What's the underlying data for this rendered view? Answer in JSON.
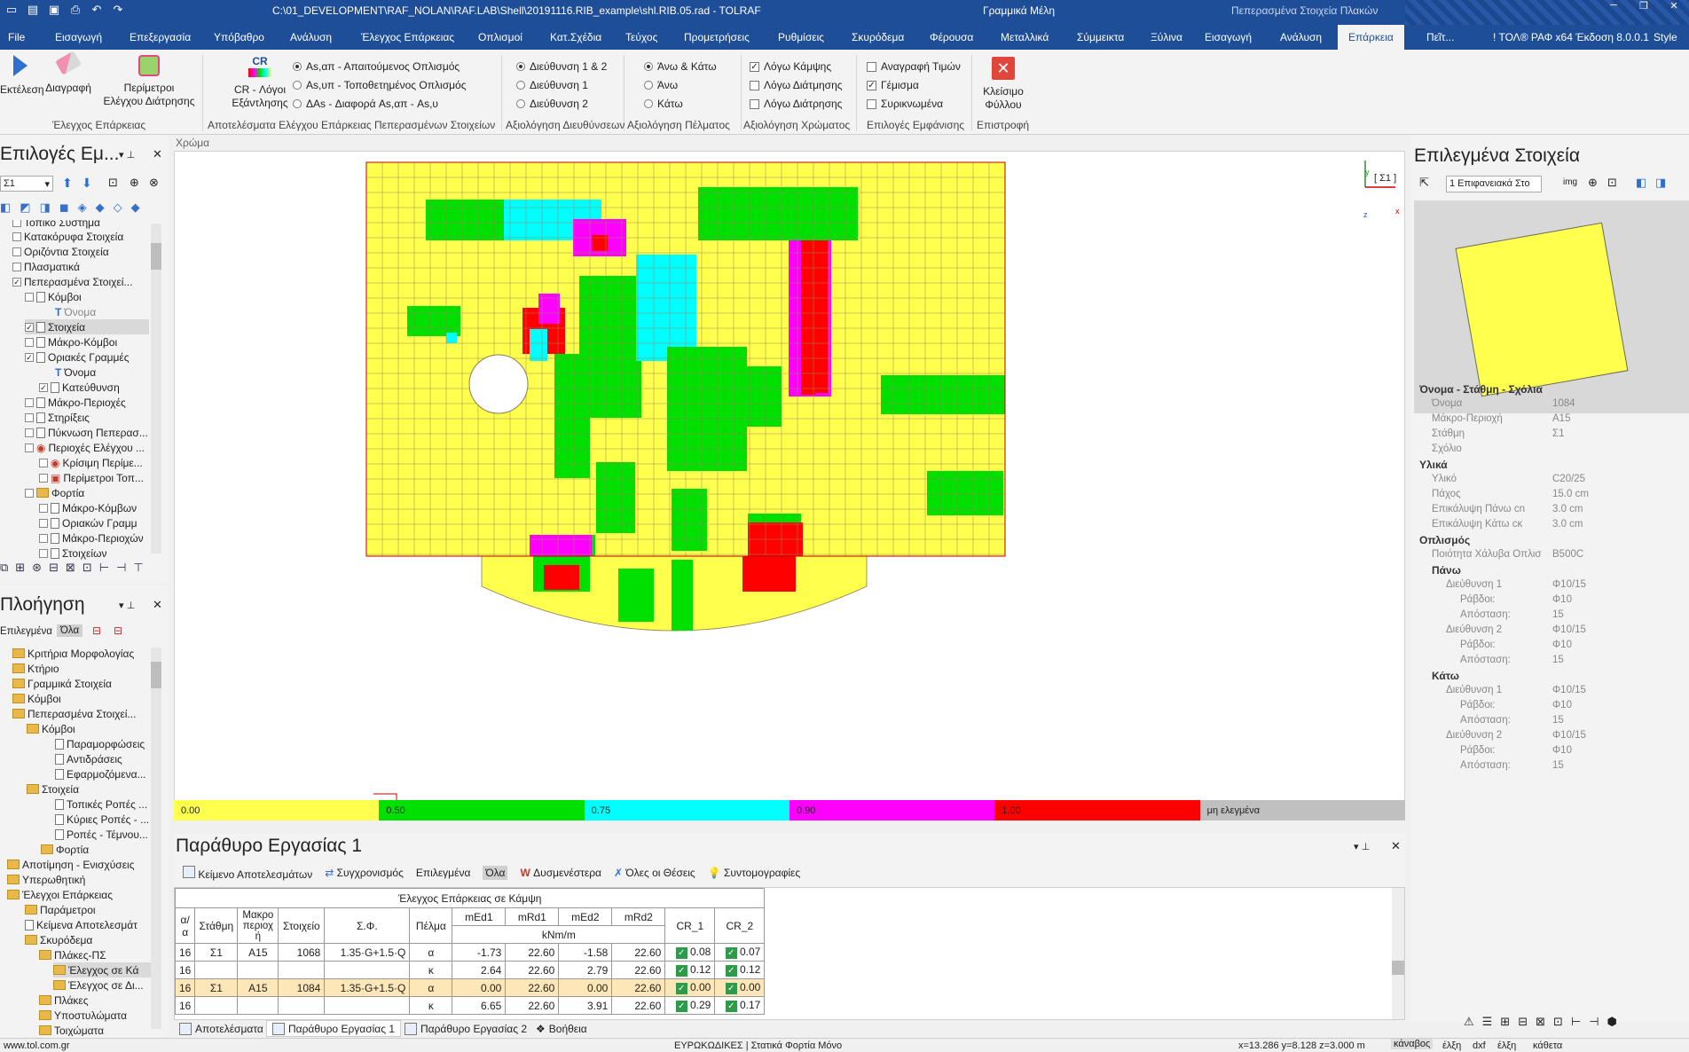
{
  "title_bar": {
    "path": "C:\\01_DEVELOPMENT\\RAF_NOLAN\\RAF.LAB\\Shell\\20191116.RIB_example\\shl.RIB.05.rad - TOLRAF",
    "context1": "Γραμμικά Μέλη",
    "context2": "Πεπερασμένα Στοιχεία Πλακών"
  },
  "menu": {
    "items": [
      "File",
      "Εισαγωγή",
      "Επεξεργασία",
      "Υπόβαθρο",
      "Ανάλυση",
      "Έλεγχος Επάρκειας",
      "Οπλισμοί",
      "Κατ.Σχέδια",
      "Τεύχος",
      "Προμετρήσεις",
      "Ρυθμίσεις",
      "Σκυρόδεμα",
      "Φέρουσα",
      "Μεταλλικά",
      "Σύμμεικτα",
      "Ξύλινα",
      "Εισαγωγή",
      "Ανάλυση",
      "Επάρκεια"
    ],
    "search": "Πεῖτ...",
    "version": "! ΤΟΛ® ΡΑΦ x64 Έκδοση 8.0.0.1",
    "style": "Style"
  },
  "ribbon": {
    "run_label": "Εκτέλεση",
    "delete_label": "Διαγραφή",
    "perimeter_label1": "Περίμετροι",
    "perimeter_label2": "Ελέγχου Διάτρησης",
    "cr_icon_text": "CR",
    "cr_label1": "CR - Λόγοι",
    "cr_label2": "Εξάντλησης",
    "results_opts": [
      "As,απ - Απαιτούμενος Οπλισμός",
      "As,υπ - Τοποθετημένος Οπλισμός",
      "ΔAs - Διαφορά As,απ - As,υ"
    ],
    "direction_opts": [
      "Διεύθυνση 1 & 2",
      "Διεύθυνση 1",
      "Διεύθυνση 2"
    ],
    "flange_opts": [
      "Άνω & Κάτω",
      "Άνω",
      "Κάτω"
    ],
    "color_opts": [
      "Λόγω Κάμψης",
      "Λόγω Διάτμησης",
      "Λόγω Διάτρησης"
    ],
    "display_opts": [
      "Αναγραφή Τιμών",
      "Γέμισμα",
      "Συρικνωμένα"
    ],
    "close_label1": "Κλείσιμο",
    "close_label2": "Φύλλου",
    "groups": [
      "Έλεγχος Επάρκειας",
      "Αποτελέσματα Ελέγχου Επάρκειας Πεπερασμένων Στοιχείων",
      "Αξιολόγηση Διευθύνσεων",
      "Αξιολόγηση Πέλματος",
      "Αξιολόγηση Χρώματος",
      "Επιλογές Εμφάνισης",
      "Επιστροφή"
    ]
  },
  "left_top_panel": {
    "title": "Επιλογές Εμ...",
    "level": "Σ1",
    "rows": [
      "Τοπικό Σύστημα",
      "Κατακόρυφα Στοιχεία",
      "Οριζόντια Στοιχεία",
      "Πλασματικά",
      "Πεπερασμένα Στοιχεί...",
      "Κόμβοι",
      "Όνομα",
      "Στοιχεία",
      "Μάκρο-Κόμβοι",
      "Οριακές Γραμμές",
      "Όνομα",
      "Κατεύθυνση",
      "Μάκρο-Περιοχές",
      "Στηρίξεις",
      "Πύκνωση Πεπερασ...",
      "Περιοχές Ελέγχου ...",
      "Κρίσιμη Περίμε...",
      "Περίμετροι Τοπ...",
      "Φορτία",
      "Μάκρο-Κόμβων",
      "Οριακών Γραμμ",
      "Μάκρο-Περιοχών",
      "Στοιχείων"
    ]
  },
  "left_bottom_panel": {
    "title": "Πλοήγηση",
    "filter_selected": "Επιλεγμένα",
    "filter_all": "Όλα",
    "rows": [
      "Κριτήρια Μορφολογίας",
      "Κτήριο",
      "Γραμμικά Στοιχεία",
      "Κόμβοι",
      "Πεπερασμένα Στοιχεί...",
      "Κόμβοι",
      "Παραμορφώσεις",
      "Αντιδράσεις",
      "Εφαρμοζόμενα...",
      "Στοιχεία",
      "Τοπικές Ροπές ...",
      "Κύριες Ροπές - ...",
      "Ροπές - Τέμνου...",
      "Φορτία",
      "Αποτίμηση - Ενισχύσεις",
      "Υπερωθητική",
      "Έλεγχοι Επάρκειας",
      "Παράμετροι",
      "Κείμενα Αποτελεσμάτ",
      "Σκυρόδεμα",
      "Πλάκες-ΠΣ",
      "Έλεγχος σε Κά",
      "Έλεγχος σε Δι...",
      "Πλάκες",
      "Υποστυλώματα",
      "Τοιχώματα"
    ]
  },
  "canvas": {
    "header": "Χρώμα",
    "view_tag": "[ Σ1 ]",
    "axis_y": "y",
    "axis_z": "z",
    "axis_x": "x",
    "legend": [
      "0.00",
      "0.50",
      "0.75",
      "0.90",
      "1.00",
      "μη ελεγμένα"
    ],
    "legend_colors": [
      "#ffff4d",
      "#00e000",
      "#00ffff",
      "#ff00ff",
      "#ff0000",
      "#c0c0c0"
    ]
  },
  "work_panel": {
    "title": "Παράθυρο Εργασίας 1",
    "toolbar": [
      "Κείμενο Αποτελεσμάτων",
      "Συγχρονισμός",
      "Επιλεγμένα",
      "Όλα",
      "Δυσμενέστερα",
      "Όλες οι Θέσεις",
      "Συντομογραφίες"
    ],
    "table_title": "Έλεγχος Επάρκειας σε Κάμψη",
    "headers": [
      "α/α",
      "Στάθμη",
      "Μακροπεριοχή",
      "Στοιχείο",
      "Σ.Φ.",
      "Πέλμα",
      "mEd1",
      "mRd1",
      "mEd2",
      "mRd2",
      "CR_1",
      "CR_2"
    ],
    "unit": "kNm/m",
    "rows": [
      [
        "16",
        "Σ1",
        "A15",
        "1068",
        "1.35·G+1.5·Q",
        "α",
        "-1.73",
        "22.60",
        "-1.58",
        "22.60",
        "0.08",
        "0.07"
      ],
      [
        "16",
        "",
        "",
        "",
        "",
        "κ",
        "2.64",
        "22.60",
        "2.79",
        "22.60",
        "0.12",
        "0.12"
      ],
      [
        "16",
        "Σ1",
        "A15",
        "1084",
        "1.35·G+1.5·Q",
        "α",
        "0.00",
        "22.60",
        "0.00",
        "22.60",
        "0.00",
        "0.00"
      ],
      [
        "16",
        "",
        "",
        "",
        "",
        "κ",
        "6.65",
        "22.60",
        "3.91",
        "22.60",
        "0.29",
        "0.17"
      ]
    ]
  },
  "right_panel": {
    "title": "Επιλεγμένα Στοιχεία",
    "dropdown": "1 Επιφανειακά Στο",
    "img_btn": "img",
    "sections": {
      "name": "Όνομα - Στάθμη - Σχόλια",
      "materials": "Υλικά",
      "reinforcement": "Οπλισμός",
      "top": "Πάνω",
      "bottom": "Κάτω"
    },
    "props": {
      "name_k": "Όνομα",
      "name_v": "1084",
      "macro_k": "Μάκρο-Περιοχή",
      "macro_v": "A15",
      "level_k": "Στάθμη",
      "level_v": "Σ1",
      "comment_k": "Σχόλιο",
      "mat_k": "Υλικό",
      "mat_v": "C20/25",
      "thick_k": "Πάχος",
      "thick_v": "15.0 cm",
      "covtop_k": "Επικάλυψη Πάνω cn",
      "covtop_v": "3.0 cm",
      "covbot_k": "Επικάλυψη Κάτω cκ",
      "covbot_v": "3.0 cm",
      "steel_k": "Ποιότητα Χάλυβα Οπλισ",
      "steel_v": "B500C",
      "dir1": "Διεύθυνση 1",
      "dir2": "Διεύθυνση 2",
      "bar_v": "Φ10/15",
      "bars_k": "Ράβδοι:",
      "bars_v": "Φ10",
      "spacing_k": "Απόσταση:",
      "spacing_v": "15"
    }
  },
  "bottom_tabs": [
    "Αποτελέσματα",
    "Παράθυρο Εργασίας 1",
    "Παράθυρο Εργασίας 2",
    "Βοήθεια"
  ],
  "status": {
    "site": "www.tol.com.gr",
    "code": "ΕΥΡΩΚΩΔΙΚΕΣ | Στατικά Φορτία Μόνο",
    "coords": "x=13.286 y=8.128 z=3.000 m",
    "b1": "κάναβος",
    "b2": "έλξη",
    "b3": "dxf",
    "b4": "έλξη",
    "b5": "κάθετα"
  }
}
